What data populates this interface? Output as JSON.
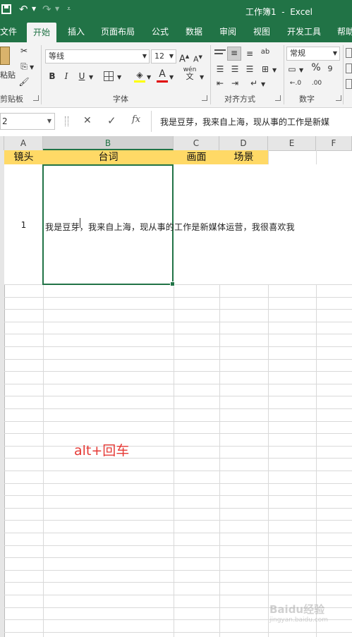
{
  "title_bar": {
    "document_title": "工作簿1  -  Excel",
    "save_icon": "save-icon",
    "undo_icon": "undo-icon",
    "redo_icon": "redo-icon",
    "customize_icon": "chevron-down-icon"
  },
  "ribbon_tabs": [
    {
      "label": "文件"
    },
    {
      "label": "开始"
    },
    {
      "label": "插入"
    },
    {
      "label": "页面布局"
    },
    {
      "label": "公式"
    },
    {
      "label": "数据"
    },
    {
      "label": "审阅"
    },
    {
      "label": "视图"
    },
    {
      "label": "开发工具"
    },
    {
      "label": "帮助"
    }
  ],
  "ribbon": {
    "clipboard": {
      "paste_label": "粘贴",
      "group_label": "剪贴板"
    },
    "font": {
      "font_name": "等线",
      "font_size": "12",
      "grow": "A",
      "shrink": "A",
      "bold": "B",
      "italic": "I",
      "underline": "U",
      "font_color_glyph": "A",
      "phonetic_top": "wén",
      "phonetic_bottom": "文",
      "group_label": "字体"
    },
    "alignment": {
      "wrap_glyph": "ab",
      "group_label": "对齐方式"
    },
    "number": {
      "format": "常规",
      "percent": "%",
      "comma": "9",
      "inc_decimal": "←.0",
      "dec_decimal": ".00",
      "group_label": "数字"
    }
  },
  "formula_bar": {
    "name_box": "2",
    "fx": "fx",
    "cancel": "✕",
    "enter": "✓",
    "content": "我是豆芽，我来自上海，现从事的工作是新媒"
  },
  "columns": [
    {
      "label": "A"
    },
    {
      "label": "B"
    },
    {
      "label": "C"
    },
    {
      "label": "D"
    },
    {
      "label": "E"
    },
    {
      "label": "F"
    }
  ],
  "header_row": {
    "a": "镜头",
    "b": "台词",
    "c": "画面",
    "d": "场景"
  },
  "data_row": {
    "a": "1",
    "b": "我是豆芽，我来自上海，现从事的工作是新媒体运营，我很喜欢我"
  },
  "annotation": "alt+回车",
  "colors": {
    "excel_green": "#217346",
    "header_fill": "#ffd966",
    "annotation_red": "#e53935"
  },
  "watermark": {
    "main": "Baidu经验",
    "sub": "jingyan.baidu.com"
  }
}
